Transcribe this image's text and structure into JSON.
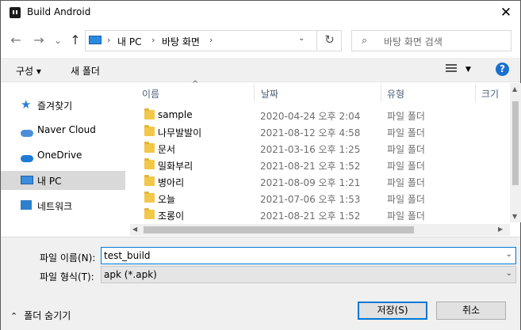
{
  "window": {
    "title": "Build Android"
  },
  "nav": {
    "back": "←",
    "forward": "→",
    "recent": "⌄",
    "up": "↑",
    "breadcrumbs": [
      "내 PC",
      "바탕 화면"
    ],
    "refresh": "↻",
    "search_placeholder": "바탕 화면 검색"
  },
  "toolbar": {
    "organize": "구성 ▾",
    "new_folder": "새 폴더",
    "help": "?"
  },
  "sidebar": {
    "items": [
      {
        "label": "즐겨찾기",
        "icon": "star-icon"
      },
      {
        "label": "Naver Cloud",
        "icon": "naver-cloud-icon"
      },
      {
        "label": "OneDrive",
        "icon": "onedrive-cloud-icon"
      },
      {
        "label": "내 PC",
        "icon": "pc-icon",
        "selected": true
      },
      {
        "label": "네트워크",
        "icon": "network-icon"
      }
    ]
  },
  "columns": {
    "name": "이름",
    "date": "날짜",
    "type": "유형",
    "size": "크기"
  },
  "files": [
    {
      "name": "sample",
      "date": "2020-04-24 오후 2:04",
      "type": "파일 폴더"
    },
    {
      "name": "나무발발이",
      "date": "2021-08-12 오후 4:58",
      "type": "파일 폴더"
    },
    {
      "name": "문서",
      "date": "2021-03-16 오후 1:25",
      "type": "파일 폴더"
    },
    {
      "name": "밀화부리",
      "date": "2021-08-21 오후 1:52",
      "type": "파일 폴더"
    },
    {
      "name": "병아리",
      "date": "2021-08-09 오후 1:21",
      "type": "파일 폴더"
    },
    {
      "name": "오늘",
      "date": "2021-07-06 오후 1:53",
      "type": "파일 폴더"
    },
    {
      "name": "조롱이",
      "date": "2021-08-21 오후 1:52",
      "type": "파일 폴더"
    }
  ],
  "form": {
    "filename_label": "파일 이름(N):",
    "filename_value": "test_build",
    "filetype_label": "파일 형식(T):",
    "filetype_value": "apk (*.apk)"
  },
  "footer": {
    "hide_folders": "폴더 숨기기",
    "save": "저장(S)",
    "cancel": "취소"
  }
}
